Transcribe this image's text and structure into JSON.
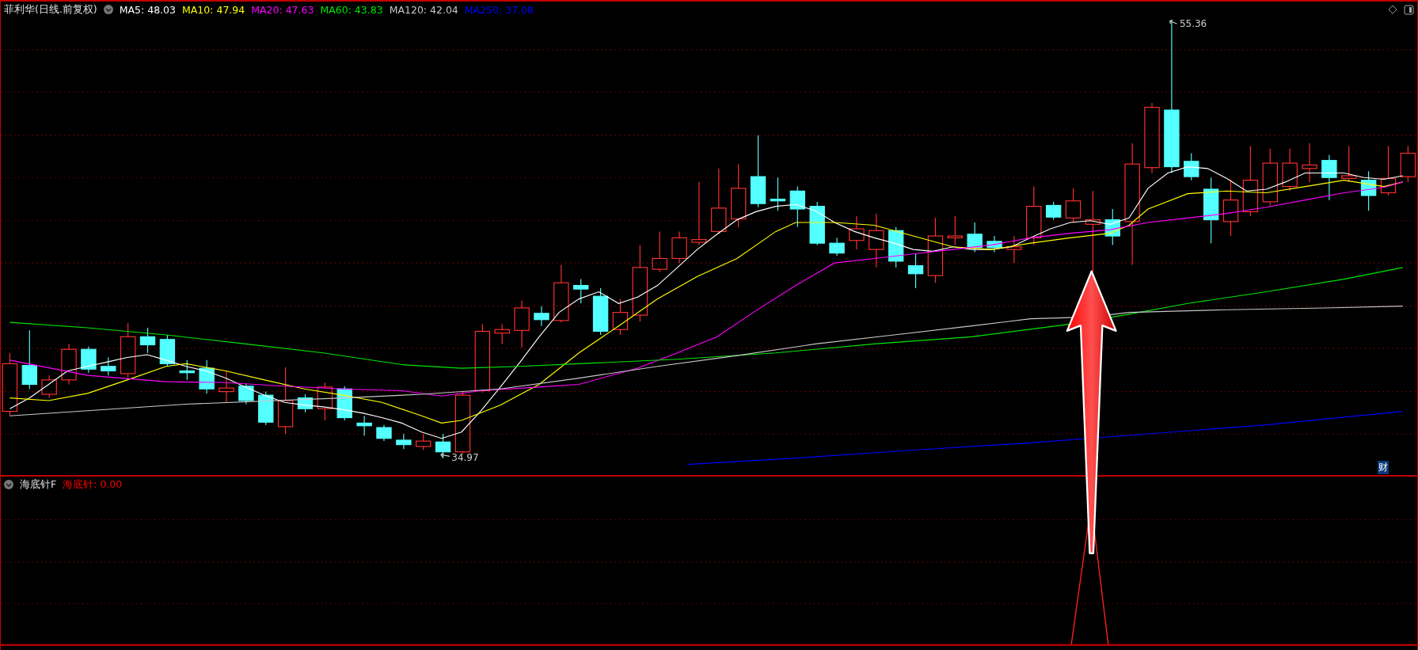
{
  "header": {
    "title": "菲利华(日线.前复权)",
    "moving_averages": [
      {
        "text": "MA5: 48.03",
        "color": "#ffffff"
      },
      {
        "text": "MA10: 47.94",
        "color": "#ffff00"
      },
      {
        "text": "MA20: 47.63",
        "color": "#ff00ff"
      },
      {
        "text": "MA60: 43.83",
        "color": "#00e600"
      },
      {
        "text": "MA120: 42.04",
        "color": "#c8c8c8"
      },
      {
        "text": "MA250: 37.08",
        "color": "#0000ff"
      }
    ]
  },
  "price_chart": {
    "high_label": "55.36",
    "low_label": "34.97",
    "badge": "财"
  },
  "indicator": {
    "name": "海底针F",
    "reading": "海底针: 0.00"
  }
}
